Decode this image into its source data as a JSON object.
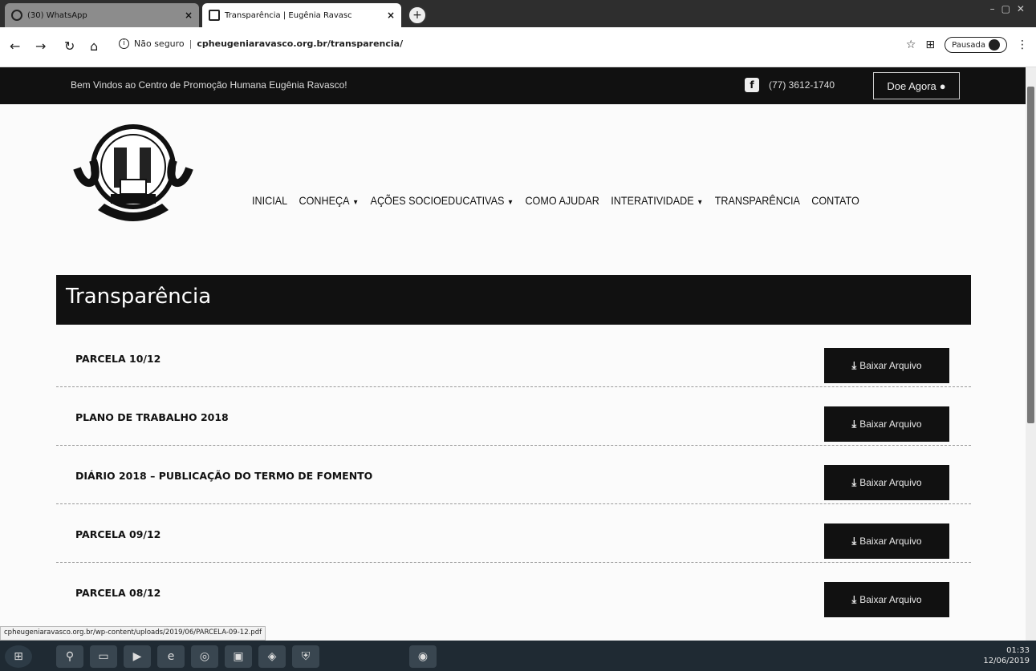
{
  "browser": {
    "tabs": [
      {
        "label": "(30) WhatsApp",
        "active": false
      },
      {
        "label": "Transparência | Eugênia Ravasc",
        "active": true
      }
    ],
    "close_glyph": "×",
    "address": {
      "security_text": "Não seguro",
      "url": "cpheugeniaravasco.org.br/transparencia/"
    },
    "profile_button": "Pausada"
  },
  "topbar": {
    "welcome": "Bem Vindos ao Centro de Promoção Humana Eugênia Ravasco!",
    "phone": "(77) 3612-1740",
    "donate": "Doe Agora"
  },
  "nav": {
    "items": [
      {
        "label": "INICIAL",
        "dropdown": false
      },
      {
        "label": "CONHEÇA",
        "dropdown": true
      },
      {
        "label": "AÇÕES SOCIOEDUCATIVAS",
        "dropdown": true
      },
      {
        "label": "COMO AJUDAR",
        "dropdown": false
      },
      {
        "label": "INTERATIVIDADE",
        "dropdown": true
      },
      {
        "label": "TRANSPARÊNCIA",
        "dropdown": false
      },
      {
        "label": "CONTATO",
        "dropdown": false
      }
    ]
  },
  "page": {
    "title": "Transparência"
  },
  "documents": [
    {
      "name": "PARCELA 10/12",
      "button": "Baixar Arquivo"
    },
    {
      "name": "PLANO DE TRABALHO 2018",
      "button": "Baixar Arquivo"
    },
    {
      "name": "DIÁRIO 2018 – PUBLICAÇÃO DO TERMO DE FOMENTO",
      "button": "Baixar Arquivo"
    },
    {
      "name": "PARCELA 09/12",
      "button": "Baixar Arquivo"
    },
    {
      "name": "PARCELA 08/12",
      "button": "Baixar Arquivo"
    }
  ],
  "status_link": "cpheugeniaravasco.org.br/wp-content/uploads/2019/06/PARCELA-09-12.pdf",
  "taskbar": {
    "time": "01:33",
    "date": "12/06/2019"
  },
  "colors": {
    "topbar_bg": "#111111",
    "title_bg": "#111111",
    "button_bg": "#111111"
  }
}
